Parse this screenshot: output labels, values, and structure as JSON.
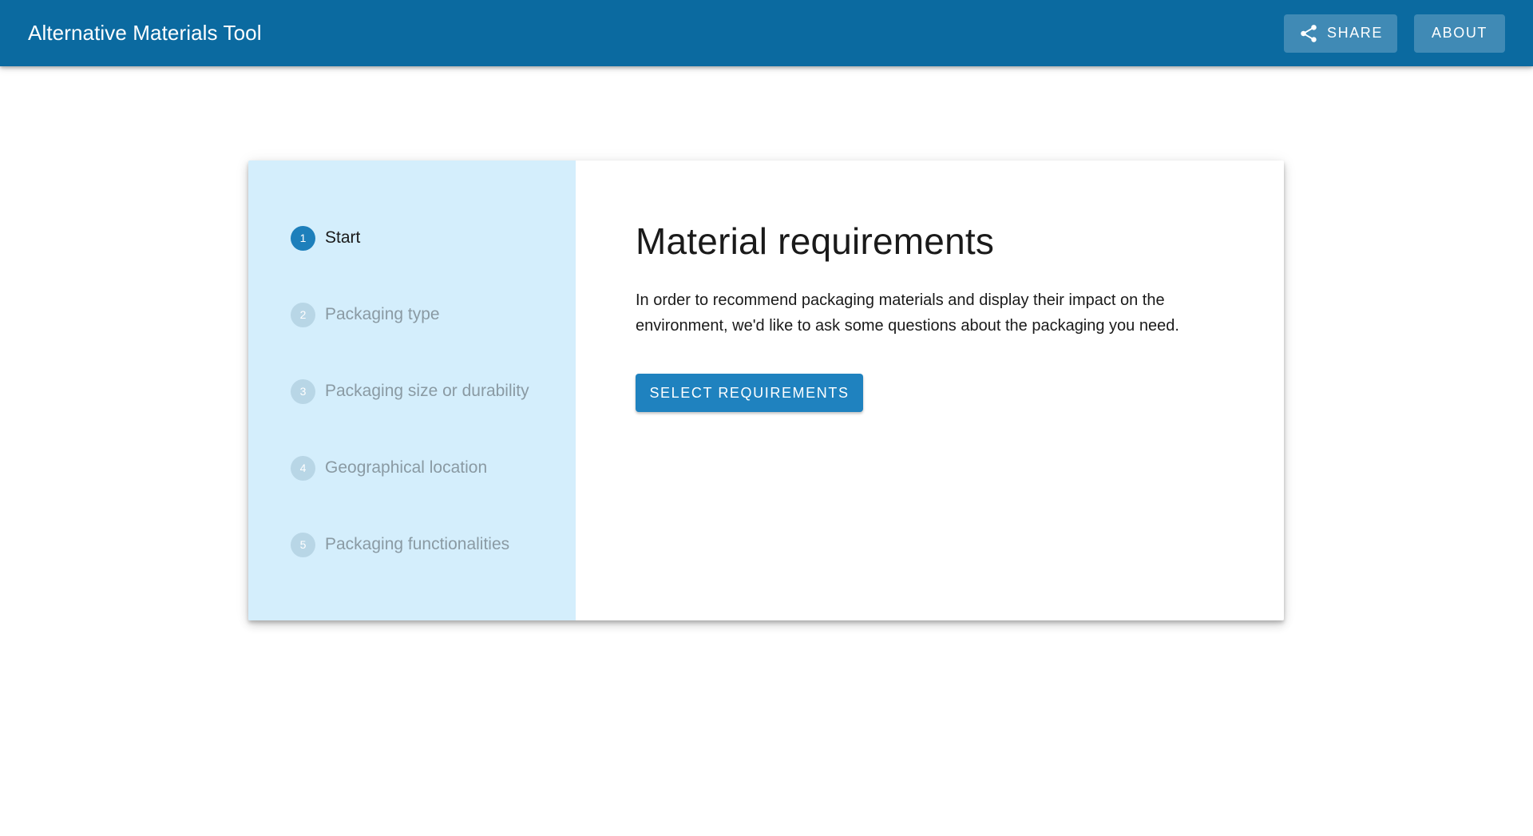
{
  "header": {
    "title": "Alternative Materials Tool",
    "share_label": "SHARE",
    "share_icon": "share-icon",
    "about_label": "ABOUT"
  },
  "colors": {
    "app_bar": "#0b6aa0",
    "stepper_bg": "#d4eefc",
    "primary": "#1f82bf",
    "active_step": "#1d7fbb",
    "inactive_step": "#b8d6e6"
  },
  "stepper": {
    "steps": [
      {
        "number": "1",
        "label": "Start",
        "active": true
      },
      {
        "number": "2",
        "label": "Packaging type",
        "active": false
      },
      {
        "number": "3",
        "label": "Packaging size or durability",
        "active": false
      },
      {
        "number": "4",
        "label": "Geographical location",
        "active": false
      },
      {
        "number": "5",
        "label": "Packaging functionalities",
        "active": false
      }
    ]
  },
  "main": {
    "title": "Material requirements",
    "description": "In order to recommend packaging materials and display their impact on the environment, we'd like to ask some questions about the packaging you need.",
    "button_label": "SELECT REQUIREMENTS"
  }
}
